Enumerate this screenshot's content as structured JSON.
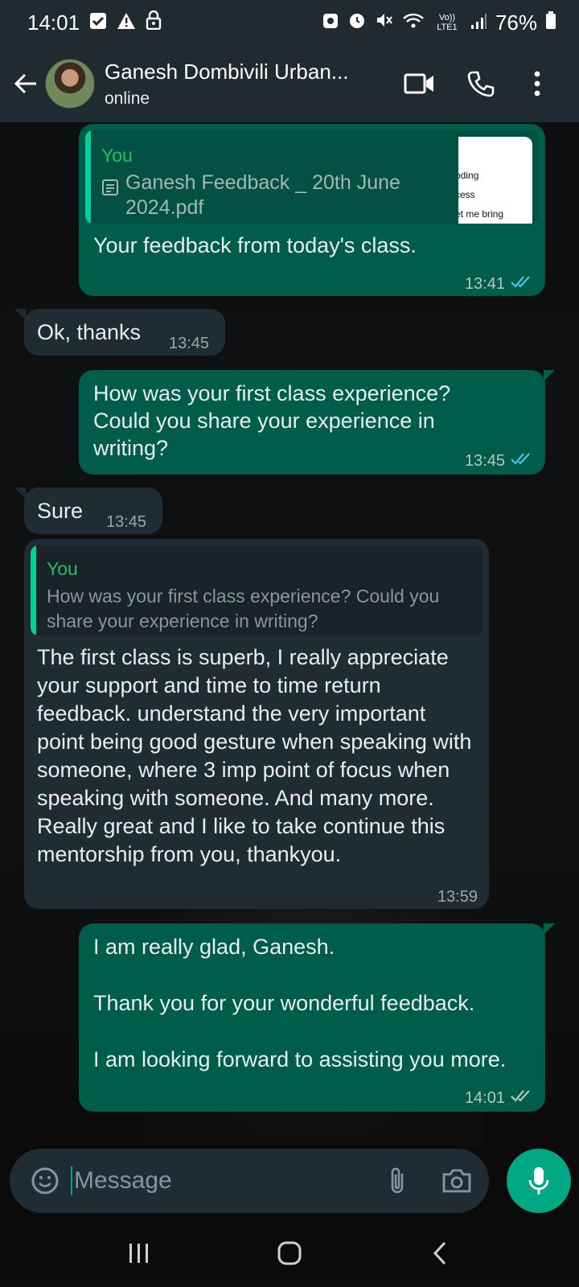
{
  "status_bar": {
    "time": "14:01",
    "battery": "76%",
    "network": "Vo)) LTE1"
  },
  "header": {
    "contact_name": "Ganesh Dombivili Urban...",
    "contact_status": "online"
  },
  "messages": [
    {
      "direction": "out",
      "quote_author": "You",
      "quote_text": "Ganesh Feedback _ 20th June 2024.pdf",
      "pdf_preview_lines": [
        "oding",
        "cess",
        "et me bring"
      ],
      "text": "Your feedback from today's class.",
      "time": "13:41",
      "read": true
    },
    {
      "direction": "in",
      "text": "Ok, thanks",
      "time": "13:45"
    },
    {
      "direction": "out",
      "text": "How was your first class experience? Could you share your experience in writing?",
      "time": "13:45",
      "read": true
    },
    {
      "direction": "in",
      "text": "Sure",
      "time": "13:45"
    },
    {
      "direction": "in",
      "quote_author": "You",
      "quote_text": "How was your first class experience? Could you share your experience in writing?",
      "text": "The first class is superb, I really appreciate your support and time to time return feedback. understand the very important point being good gesture when speaking with someone, where 3 imp point of focus when speaking with someone. And many more. Really great and I like to take continue this mentorship from you, thankyou.",
      "time": "13:59"
    },
    {
      "direction": "out",
      "text_lines": [
        "I am really glad, Ganesh.",
        "Thank you for your wonderful feedback.",
        "I am looking forward to assisting you more."
      ],
      "time": "14:01",
      "read": false
    }
  ],
  "input": {
    "placeholder": "Message"
  },
  "colors": {
    "outgoing_bubble": "#005c4b",
    "incoming_bubble": "#1f2c34",
    "accent": "#00a884",
    "read_ticks": "#53bdeb"
  }
}
